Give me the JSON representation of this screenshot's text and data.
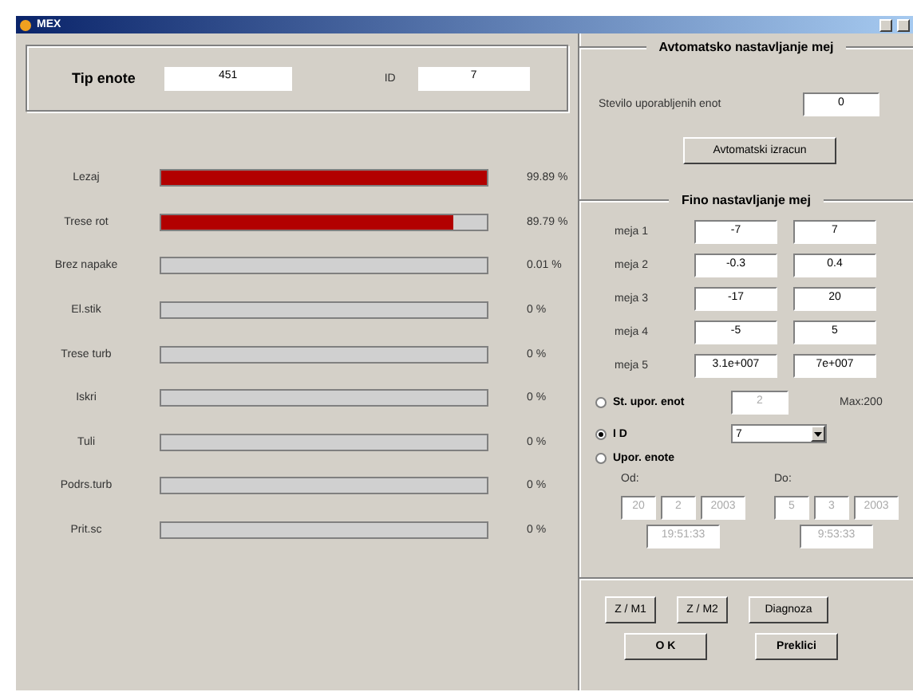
{
  "window": {
    "title": "MEX"
  },
  "unit": {
    "type_label": "Tip enote",
    "type_value": "451",
    "id_label": "ID",
    "id_value": "7"
  },
  "bars": [
    {
      "name": "Lezaj",
      "level": 0.9989,
      "reading": "99.89 %"
    },
    {
      "name": "Trese rot",
      "level": 0.8979,
      "reading": "89.79 %"
    },
    {
      "name": "Brez napake",
      "level": 0.0001,
      "reading": "0.01 %"
    },
    {
      "name": "El.stik",
      "level": 0,
      "reading": "0 %"
    },
    {
      "name": "Trese turb",
      "level": 0,
      "reading": "0 %"
    },
    {
      "name": "Iskri",
      "level": 0,
      "reading": "0 %"
    },
    {
      "name": "Tuli",
      "level": 0,
      "reading": "0 %"
    },
    {
      "name": "Podrs.turb",
      "level": 0,
      "reading": "0 %"
    },
    {
      "name": "Prit.sc",
      "level": 0,
      "reading": "0 %"
    }
  ],
  "auto": {
    "title": "Avtomatsko nastavljanje mej",
    "count_label": "Stevilo uporabljenih enot",
    "count_value": "0",
    "button": "Avtomatski izracun"
  },
  "fine": {
    "title": "Fino nastavljanje mej",
    "limits": [
      {
        "label": "meja 1",
        "min": "-7",
        "max": "7"
      },
      {
        "label": "meja 2",
        "min": "-0.3",
        "max": "0.4"
      },
      {
        "label": "meja 3",
        "min": "-17",
        "max": "20"
      },
      {
        "label": "meja 4",
        "min": "-5",
        "max": "5"
      },
      {
        "label": "meja 5",
        "min": "3.1e+007",
        "max": "7e+007"
      }
    ]
  },
  "modes": [
    {
      "kind": "count",
      "label": "St. upor. enot",
      "selected": false,
      "value": "2",
      "note": "Max:200"
    },
    {
      "kind": "select",
      "label": "I D",
      "selected": true,
      "value": "7"
    },
    {
      "kind": "range",
      "label": "Upor. enote",
      "selected": false
    }
  ],
  "range": {
    "from_label": "Od:",
    "from_date": [
      "20",
      "2",
      "2003"
    ],
    "from_time": "19:51:33",
    "to_label": "Do:",
    "to_date": [
      "5",
      "3",
      "2003"
    ],
    "to_time": "9:53:33"
  },
  "buttons": {
    "row1": [
      "Z / M1",
      "Z / M2",
      "Diagnoza"
    ],
    "row2": [
      "O K",
      "Preklici"
    ]
  }
}
